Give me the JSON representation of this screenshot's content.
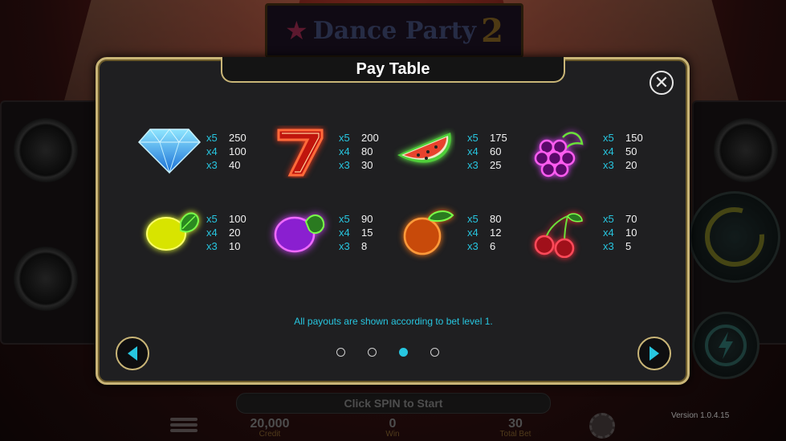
{
  "background": {
    "logo_text": "Dance Party",
    "logo_number": "2",
    "spin_hint": "Click SPIN to Start",
    "credit_value": "20,000",
    "credit_label": "Credit",
    "win_value": "0",
    "win_label": "Win",
    "total_bet_value": "30",
    "total_bet_label": "Total Bet",
    "version": "Version 1.0.4.15"
  },
  "paytable": {
    "title": "Pay Table",
    "close_glyph": "✕",
    "footnote": "All payouts are shown according to bet level 1.",
    "page_dots": [
      false,
      false,
      true,
      false
    ],
    "symbols": [
      {
        "name": "diamond",
        "payouts": [
          {
            "mult": "x5",
            "amount": "250"
          },
          {
            "mult": "x4",
            "amount": "100"
          },
          {
            "mult": "x3",
            "amount": "40"
          }
        ]
      },
      {
        "name": "seven",
        "payouts": [
          {
            "mult": "x5",
            "amount": "200"
          },
          {
            "mult": "x4",
            "amount": "80"
          },
          {
            "mult": "x3",
            "amount": "30"
          }
        ]
      },
      {
        "name": "watermelon",
        "payouts": [
          {
            "mult": "x5",
            "amount": "175"
          },
          {
            "mult": "x4",
            "amount": "60"
          },
          {
            "mult": "x3",
            "amount": "25"
          }
        ]
      },
      {
        "name": "grapes",
        "payouts": [
          {
            "mult": "x5",
            "amount": "150"
          },
          {
            "mult": "x4",
            "amount": "50"
          },
          {
            "mult": "x3",
            "amount": "20"
          }
        ]
      },
      {
        "name": "lemon",
        "payouts": [
          {
            "mult": "x5",
            "amount": "100"
          },
          {
            "mult": "x4",
            "amount": "20"
          },
          {
            "mult": "x3",
            "amount": "10"
          }
        ]
      },
      {
        "name": "plum",
        "payouts": [
          {
            "mult": "x5",
            "amount": "90"
          },
          {
            "mult": "x4",
            "amount": "15"
          },
          {
            "mult": "x3",
            "amount": "8"
          }
        ]
      },
      {
        "name": "orange",
        "payouts": [
          {
            "mult": "x5",
            "amount": "80"
          },
          {
            "mult": "x4",
            "amount": "12"
          },
          {
            "mult": "x3",
            "amount": "6"
          }
        ]
      },
      {
        "name": "cherry",
        "payouts": [
          {
            "mult": "x5",
            "amount": "70"
          },
          {
            "mult": "x4",
            "amount": "10"
          },
          {
            "mult": "x3",
            "amount": "5"
          }
        ]
      }
    ]
  },
  "colors": {
    "accent_cyan": "#27c6e0",
    "frame_gold": "#c9b577",
    "panel_bg": "#1f1f21"
  },
  "icons": [
    "diamond-icon",
    "seven-icon",
    "watermelon-icon",
    "grapes-icon",
    "lemon-icon",
    "plum-icon",
    "orange-icon",
    "cherry-icon",
    "close-icon",
    "arrow-left-icon",
    "arrow-right-icon",
    "menu-icon",
    "chips-icon",
    "spin-icon",
    "turbo-icon"
  ]
}
